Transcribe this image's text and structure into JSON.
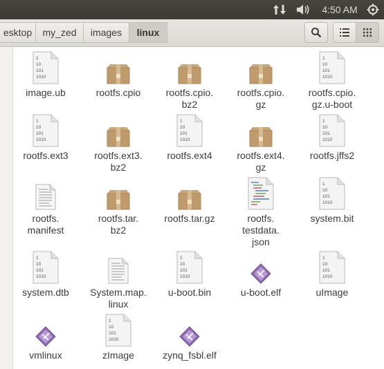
{
  "topbar": {
    "time": "4:50 AM"
  },
  "breadcrumbs": [
    {
      "label": "esktop"
    },
    {
      "label": "my_zed"
    },
    {
      "label": "images"
    },
    {
      "label": "linux"
    }
  ],
  "files": [
    {
      "name": "image.ub",
      "kind": "binary"
    },
    {
      "name": "rootfs.cpio",
      "kind": "archive"
    },
    {
      "name": "rootfs.cpio.\nbz2",
      "kind": "archive"
    },
    {
      "name": "rootfs.cpio.\ngz",
      "kind": "archive"
    },
    {
      "name": "rootfs.cpio.\ngz.u-boot",
      "kind": "binary"
    },
    {
      "name": "rootfs.ext3",
      "kind": "binary"
    },
    {
      "name": "rootfs.ext3.\nbz2",
      "kind": "archive"
    },
    {
      "name": "rootfs.ext4",
      "kind": "binary"
    },
    {
      "name": "rootfs.ext4.\ngz",
      "kind": "archive"
    },
    {
      "name": "rootfs.jffs2",
      "kind": "binary"
    },
    {
      "name": "rootfs.\nmanifest",
      "kind": "text"
    },
    {
      "name": "rootfs.tar.\nbz2",
      "kind": "archive"
    },
    {
      "name": "rootfs.tar.gz",
      "kind": "archive"
    },
    {
      "name": "rootfs.\ntestdata.\njson",
      "kind": "code"
    },
    {
      "name": "system.bit",
      "kind": "binary"
    },
    {
      "name": "system.dtb",
      "kind": "binary"
    },
    {
      "name": "System.map.\nlinux",
      "kind": "text"
    },
    {
      "name": "u-boot.bin",
      "kind": "binary"
    },
    {
      "name": "u-boot.elf",
      "kind": "executable"
    },
    {
      "name": "uImage",
      "kind": "binary"
    },
    {
      "name": "vmlinux",
      "kind": "executable"
    },
    {
      "name": "zImage",
      "kind": "binary"
    },
    {
      "name": "zynq_fsbl.elf",
      "kind": "executable"
    }
  ],
  "binary_icon_text": [
    "1",
    "10",
    "101",
    "1010"
  ],
  "colors": {
    "topbar": "#3c3b37",
    "accent": "#e95420",
    "exec_icon": "#8e6bb0"
  }
}
